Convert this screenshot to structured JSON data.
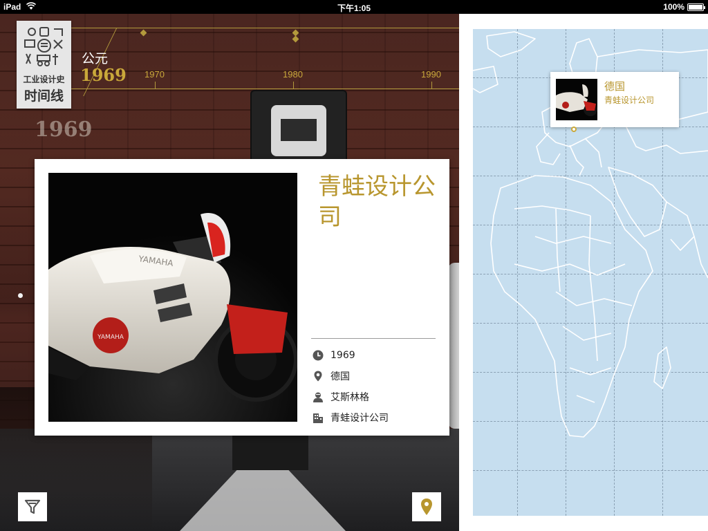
{
  "status_bar": {
    "carrier": "iPad",
    "time": "下午1:05",
    "battery": "100%"
  },
  "timeline": {
    "logo_line1": "工业设计史",
    "logo_line2": "时间线",
    "era_label": "公元",
    "current_year": "1969",
    "ticks": [
      "1970",
      "1980",
      "1990"
    ],
    "ghost_year": "1969",
    "accent_color": "#c9a83a"
  },
  "card": {
    "title": "青蛙设计公司",
    "photo_subject": "motorcycle-photo",
    "brand_text": "YAMAHA",
    "info": {
      "year": "1969",
      "country": "德国",
      "designer": "艾斯林格",
      "company": "青蛙设计公司"
    },
    "title_color": "#b8962e"
  },
  "buttons": {
    "filter_icon": "filter-icon",
    "location_icon": "map-pin-icon"
  },
  "map": {
    "popup": {
      "country": "德国",
      "company": "青蛙设计公司"
    },
    "water_color": "#c6deef"
  }
}
